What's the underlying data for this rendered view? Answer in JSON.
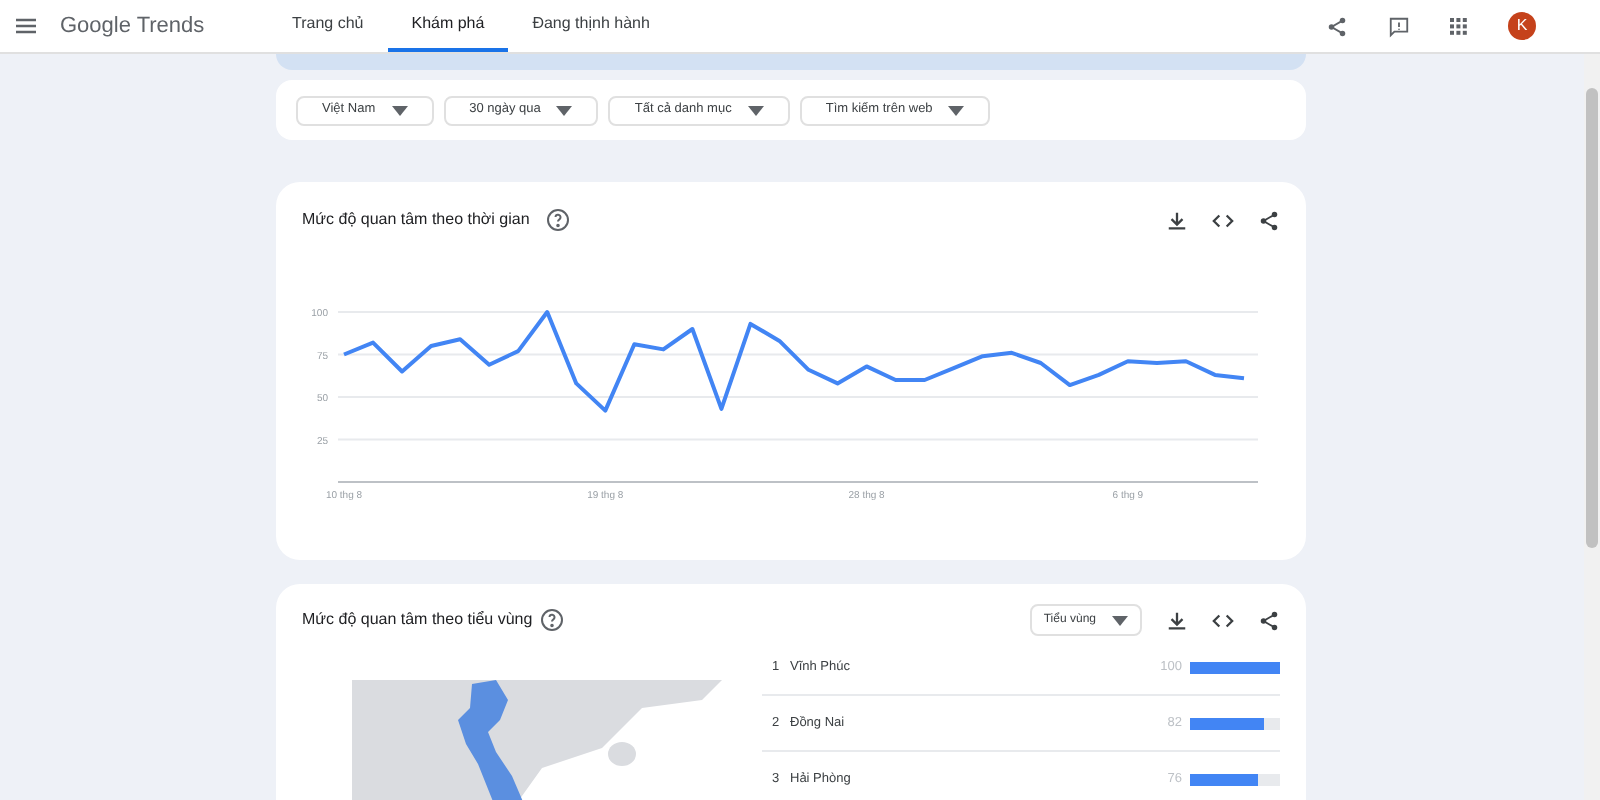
{
  "header": {
    "logo": "Google Trends",
    "tabs": [
      {
        "label": "Trang chủ",
        "selected": false
      },
      {
        "label": "Khám phá",
        "selected": true
      },
      {
        "label": "Đang thịnh hành",
        "selected": false
      }
    ],
    "avatar": "K"
  },
  "filters": [
    "Việt Nam",
    "30 ngày qua",
    "Tất cả danh mục",
    "Tìm kiếm trên web"
  ],
  "time_card": {
    "title": "Mức độ quan tâm theo thời gian",
    "chart_data": {
      "type": "line",
      "categories": [
        "10 thg 8",
        null,
        null,
        null,
        null,
        null,
        null,
        null,
        null,
        "19 thg 8",
        null,
        null,
        null,
        null,
        null,
        null,
        null,
        null,
        "28 thg 8",
        null,
        null,
        null,
        null,
        null,
        null,
        null,
        null,
        "6 thg 9",
        null,
        null,
        null,
        null
      ],
      "ylim": [
        0,
        100
      ],
      "grid": true,
      "yticks": [
        25,
        50,
        75,
        100
      ],
      "series": [
        {
          "color": "#4285f4",
          "values": [
            75,
            82,
            65,
            80,
            84,
            69,
            77,
            100,
            58,
            42,
            81,
            78,
            90,
            43,
            93,
            83,
            66,
            58,
            68,
            60,
            60,
            67,
            74,
            76,
            70,
            57,
            63,
            71,
            70,
            71,
            63,
            61
          ]
        }
      ]
    }
  },
  "region_card": {
    "title": "Mức độ quan tâm theo tiểu vùng",
    "dropdown": "Tiểu vùng",
    "rows": [
      {
        "rank": "1",
        "name": "Vĩnh Phúc",
        "value": "100",
        "level": 1
      },
      {
        "rank": "2",
        "name": "Đồng Nai",
        "value": "82",
        "level": 0.82
      },
      {
        "rank": "3",
        "name": "Hải Phòng",
        "value": "76",
        "level": 0.76
      }
    ]
  }
}
